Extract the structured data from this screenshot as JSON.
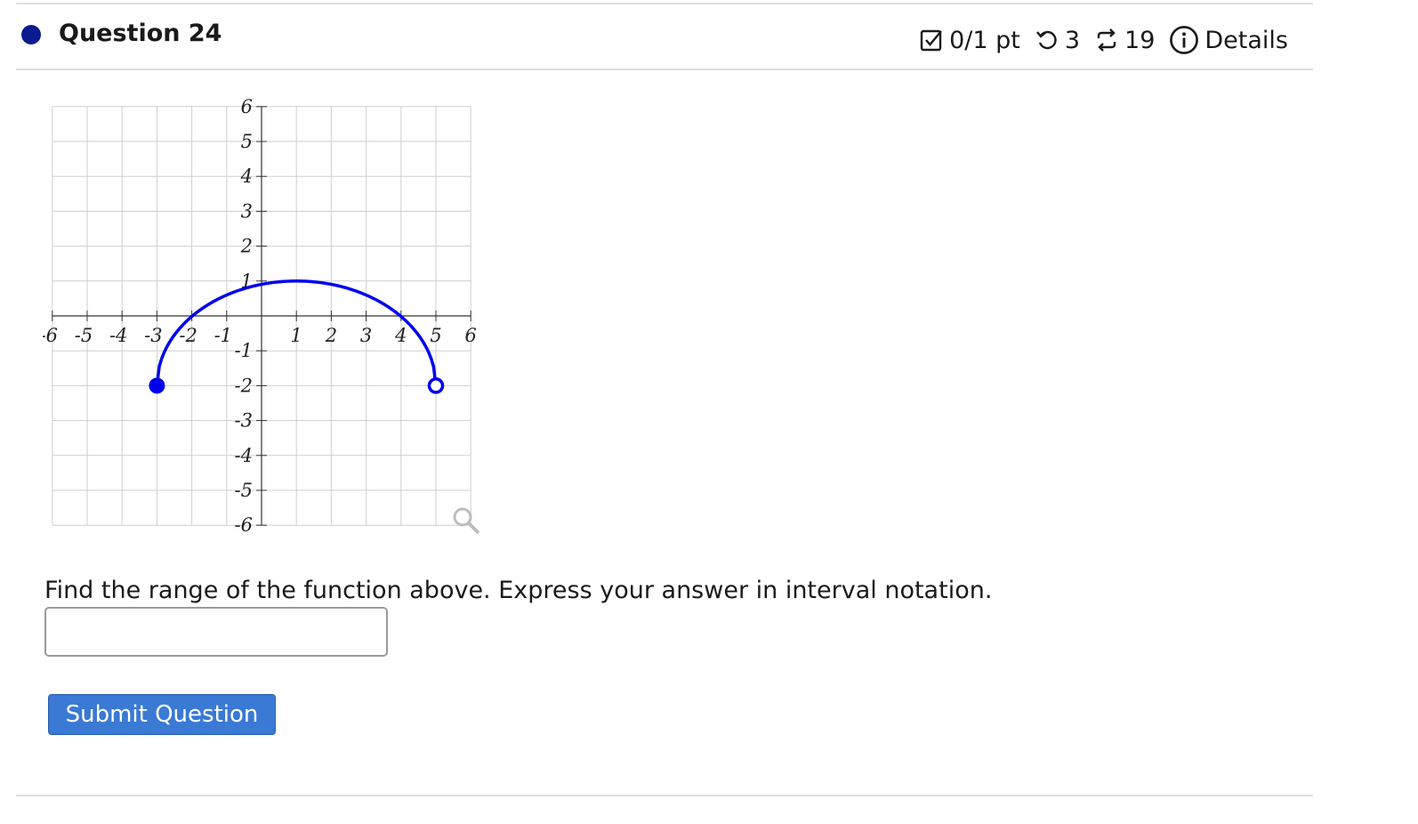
{
  "header": {
    "question_title": "Question 24",
    "score": "0/1 pt",
    "retries": "3",
    "attempts": "19",
    "details_label": "Details",
    "dot_color": "#0a1a8f"
  },
  "chart_data": {
    "type": "line",
    "xlim": [
      -6,
      6
    ],
    "ylim": [
      -6,
      6
    ],
    "grid": true,
    "x_ticks": [
      "-6",
      "-5",
      "-4",
      "-3",
      "-2",
      "-1",
      "1",
      "2",
      "3",
      "4",
      "5",
      "6"
    ],
    "y_ticks": [
      "6",
      "5",
      "4",
      "3",
      "2",
      "1",
      "-1",
      "-2",
      "-3",
      "-4",
      "-5",
      "-6"
    ],
    "curve": {
      "description": "upper semi-ellipse arc",
      "start": {
        "x": -3,
        "y": -2,
        "endpoint": "closed"
      },
      "end": {
        "x": 5,
        "y": -2,
        "endpoint": "open"
      },
      "max": {
        "x": 1,
        "y": 1
      },
      "color": "#0000ee"
    },
    "icons": [
      "magnifier-icon"
    ]
  },
  "question": {
    "prompt": "Find the range of the function above. Express your answer in interval notation.",
    "answer_value": ""
  },
  "submit_label": "Submit Question"
}
